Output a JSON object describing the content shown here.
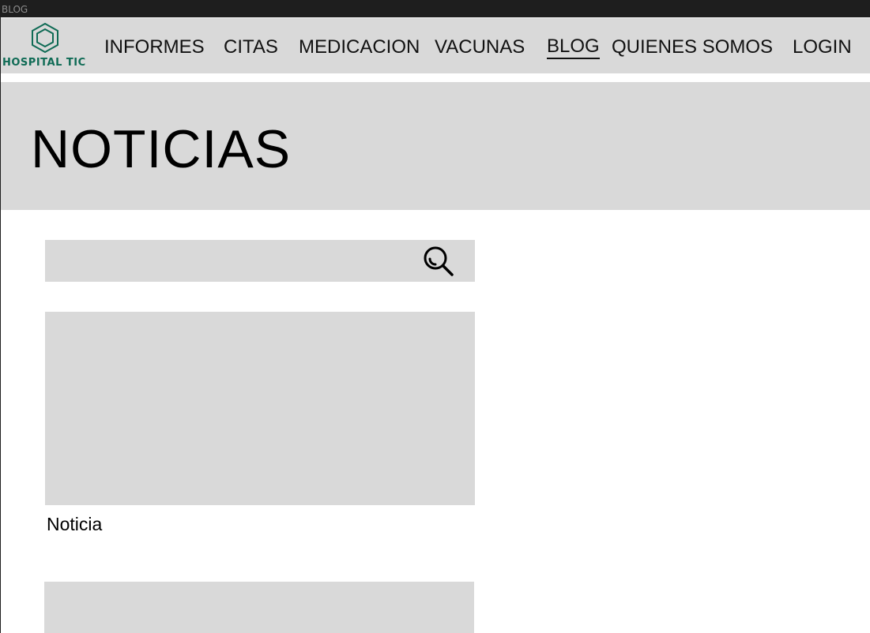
{
  "frame": {
    "label": "BLOG"
  },
  "brand": {
    "name": "HOSPITAL TIC",
    "color": "#0f6b55"
  },
  "nav": {
    "items": [
      {
        "label": "INFORMES",
        "active": false
      },
      {
        "label": "CITAS",
        "active": false
      },
      {
        "label": "MEDICACION",
        "active": false
      },
      {
        "label": "VACUNAS",
        "active": false
      },
      {
        "label": "BLOG",
        "active": true
      },
      {
        "label": "QUIENES SOMOS",
        "active": false
      },
      {
        "label": "LOGIN",
        "active": false
      }
    ]
  },
  "hero": {
    "title": "NOTICIAS"
  },
  "search": {
    "value": "",
    "icon": "search-icon"
  },
  "news": [
    {
      "title": "Noticia"
    },
    {
      "title": ""
    }
  ],
  "colors": {
    "placeholder_gray": "#d9d9d9",
    "background": "#ffffff"
  }
}
